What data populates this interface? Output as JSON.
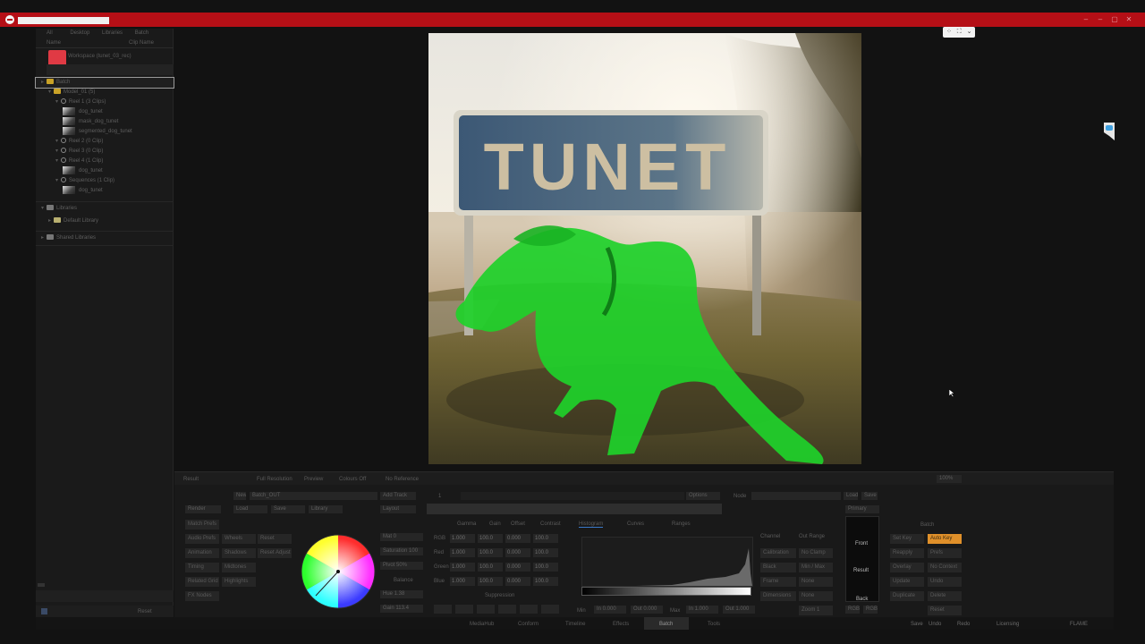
{
  "window": {
    "controls": [
      "–",
      "‒",
      "▢",
      "✕"
    ]
  },
  "media_panel": {
    "tabs": [
      "All",
      "Desktop",
      "Libraries",
      "Batch"
    ],
    "name_header": "Name",
    "clip_name_header": "Clip Name",
    "workspace_label": "Workspace (tunet_03_rec)",
    "batch_label": "Batch",
    "tree": [
      {
        "indent": 0,
        "label": "Batch",
        "kind": "folder",
        "selected": true
      },
      {
        "indent": 1,
        "label": "Model_01 (5)",
        "kind": "folder"
      },
      {
        "indent": 2,
        "label": "Reel 1  (3 Clips)",
        "kind": "reel"
      },
      {
        "indent": 3,
        "label": "dog_tunet",
        "kind": "clip"
      },
      {
        "indent": 3,
        "label": "mask_dog_tunet",
        "kind": "clip"
      },
      {
        "indent": 3,
        "label": "segmented_dog_tunet",
        "kind": "clip"
      },
      {
        "indent": 2,
        "label": "Reel 2  (0 Clip)",
        "kind": "reel"
      },
      {
        "indent": 2,
        "label": "Reel 3  (0 Clip)",
        "kind": "reel"
      },
      {
        "indent": 2,
        "label": "Reel 4  (1 Clip)",
        "kind": "reel"
      },
      {
        "indent": 3,
        "label": "dog_tunet",
        "kind": "clip"
      },
      {
        "indent": 2,
        "label": "Sequences  (1 Clip)",
        "kind": "reel"
      },
      {
        "indent": 3,
        "label": "dog_tunet",
        "kind": "clip"
      }
    ],
    "libraries_label": "Libraries",
    "default_library": "Default Library",
    "shared_libraries": "Shared Libraries",
    "bottom_button": "Reset"
  },
  "viewer": {
    "sign_text": "TUNET"
  },
  "bottom": {
    "top_bar": [
      "Result",
      "Full Resolution",
      "Preview",
      "Colours Off",
      "No Reference"
    ],
    "zoom": "100%",
    "row1": {
      "new": "New",
      "node_name": "Batch_OUT",
      "add_tracks": "Add Track",
      "frame": "1",
      "options": "Options",
      "node_label": "Node",
      "load": "Load",
      "save": "Save"
    },
    "row2": {
      "render": "Render",
      "load": "Load",
      "save": "Save",
      "library": "Library",
      "layout": "Layout",
      "primary": "Primary"
    },
    "left_buttons": [
      "Match Prefs",
      "Audio Prefs",
      "Animation",
      "Timing",
      "Related Grid",
      "FX Nodes"
    ],
    "mid_buttons": [
      "Wheels",
      "Shadows",
      "Midtones",
      "Highlights",
      "Reset",
      "Reset Adjust"
    ],
    "tabs": [
      "Gamma",
      "Gain",
      "Offset",
      "Contrast",
      "Histogram",
      "Curves",
      "Ranges"
    ],
    "wheel_fields": {
      "mat": "Mat  0",
      "saturation": "Saturation 100",
      "pivot": "Pivot 50%",
      "balance": "Balance",
      "hue": "Hue 1.38",
      "gain": "Gain 113.4"
    },
    "rows": [
      {
        "name": "RGB",
        "values": [
          "1.000",
          "100.0",
          "0.000",
          "100.0"
        ]
      },
      {
        "name": "Red",
        "values": [
          "1.000",
          "100.0",
          "0.000",
          "100.0"
        ]
      },
      {
        "name": "Green",
        "values": [
          "1.000",
          "100.0",
          "0.000",
          "100.0"
        ]
      },
      {
        "name": "Blue",
        "values": [
          "1.000",
          "100.0",
          "0.000",
          "100.0"
        ]
      }
    ],
    "suppression": "Suppression",
    "hist_fields": {
      "min": "Min",
      "in_min": "In 0.000",
      "out_min": "Out 0.000",
      "max": "Max",
      "in_max": "In 1.000",
      "out_max": "Out 1.000"
    },
    "channel_col": [
      "Channel",
      "Calibration",
      "Black",
      "Frame",
      "Dimensions"
    ],
    "range_col": [
      "Out Range",
      "No Clamp",
      "Min / Max",
      "None",
      "None",
      "Zoom 1"
    ],
    "preview_labels": {
      "front": "Front",
      "result": "Result",
      "back": "Back"
    },
    "batch_label": "Batch",
    "right_buttons": [
      [
        "Set Key",
        "Auto Key"
      ],
      [
        "Reapply",
        "Prefs"
      ],
      [
        "Overlay",
        "No Context"
      ],
      [
        "Update",
        "Undo"
      ],
      [
        "Duplicate",
        "Delete"
      ],
      [
        "",
        "Reset"
      ]
    ]
  },
  "statusbar": {
    "tabs": [
      "MediaHub",
      "Conform",
      "Timeline",
      "Effects",
      "Batch",
      "Tools"
    ],
    "active_tab": "Batch",
    "save": "Save",
    "undo": "Undo",
    "redo": "Redo",
    "licensing": "Licensing",
    "app": "FLAME"
  },
  "colors": {
    "titlebar": "#b50f16",
    "accent_key": "#e0902a",
    "matte_green": "#1ed12a"
  }
}
